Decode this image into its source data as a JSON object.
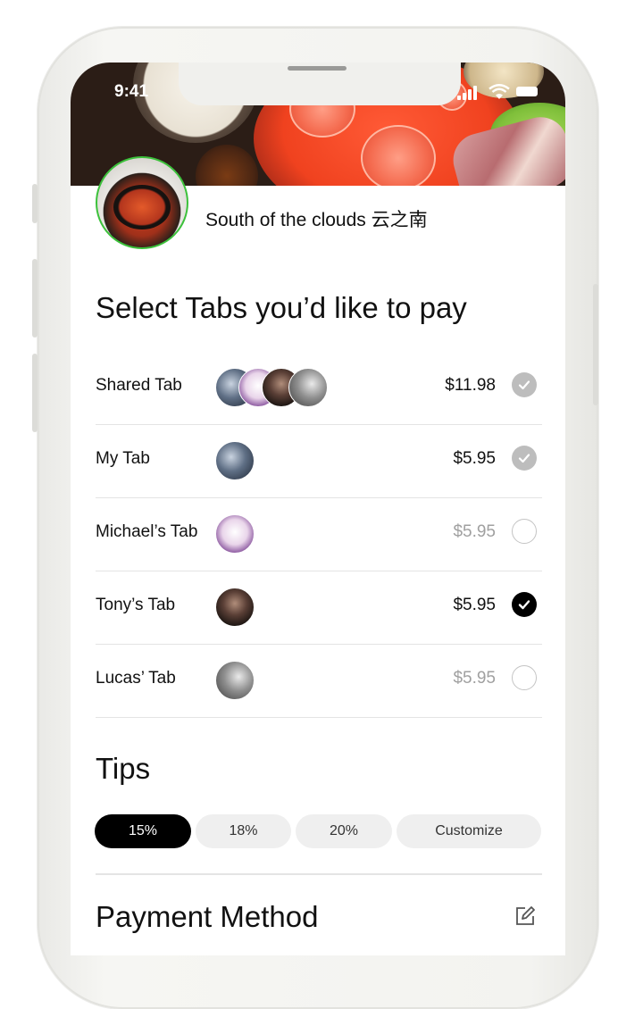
{
  "status_bar": {
    "time": "9:41"
  },
  "restaurant": {
    "name": "South of the clouds 云之南"
  },
  "tabs_section": {
    "title": "Select Tabs you’d like to pay",
    "tabs": [
      {
        "label": "Shared Tab",
        "amount": "$11.98",
        "state": "selected-grey"
      },
      {
        "label": "My Tab",
        "amount": "$5.95",
        "state": "selected-grey"
      },
      {
        "label": "Michael’s Tab",
        "amount": "$5.95",
        "state": "unselected"
      },
      {
        "label": "Tony’s Tab",
        "amount": "$5.95",
        "state": "selected"
      },
      {
        "label": "Lucas’ Tab",
        "amount": "$5.95",
        "state": "unselected"
      }
    ]
  },
  "tips": {
    "title": "Tips",
    "options": [
      "15%",
      "18%",
      "20%",
      "Customize"
    ],
    "selected": "15%"
  },
  "payment": {
    "title": "Payment Method"
  },
  "icons": {
    "check": "check-icon",
    "edit": "edit-icon",
    "signal": "signal-icon",
    "wifi": "wifi-icon",
    "battery": "battery-icon"
  }
}
